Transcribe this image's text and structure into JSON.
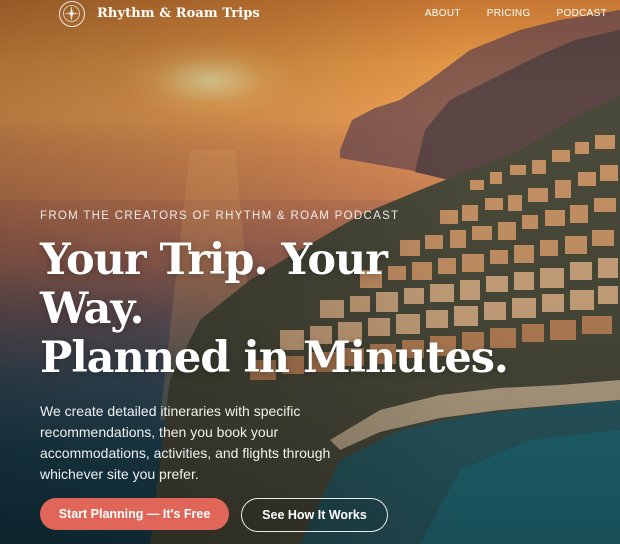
{
  "nav": {
    "brand": "Rhythm & Roam Trips",
    "logo_icon": "compass-icon",
    "links": [
      "ABOUT",
      "PRICING",
      "PODCAST"
    ]
  },
  "hero": {
    "eyebrow": "FROM THE CREATORS OF RHYTHM & ROAM PODCAST",
    "headline_lines": [
      "Your Trip. Your",
      "Way.",
      "Planned in Minutes."
    ],
    "description": "We create detailed itineraries with specific recommendations, then you book your accommodations, activities, and flights through whichever site you prefer.",
    "primary_cta": "Start Planning — It's Free",
    "secondary_cta": "See How It Works"
  },
  "colors": {
    "primary_button": "#e06659",
    "text": "#ffffff"
  }
}
